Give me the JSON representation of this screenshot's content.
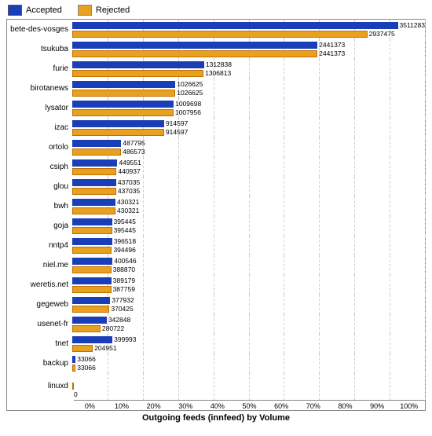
{
  "legend": {
    "accepted": {
      "label": "Accepted",
      "color": "#1a3eb8"
    },
    "rejected": {
      "label": "Rejected",
      "color": "#e8a020"
    }
  },
  "xTitle": "Outgoing feeds (innfeed) by Volume",
  "xTicks": [
    "0%",
    "10%",
    "20%",
    "30%",
    "40%",
    "50%",
    "60%",
    "70%",
    "80%",
    "90%",
    "100%"
  ],
  "maxValue": 3511283,
  "rows": [
    {
      "label": "bete-des-vosges",
      "accepted": 3511283,
      "rejected": 2937475
    },
    {
      "label": "tsukuba",
      "accepted": 2441373,
      "rejected": 2441373
    },
    {
      "label": "furie",
      "accepted": 1312838,
      "rejected": 1306813
    },
    {
      "label": "birotanews",
      "accepted": 1026625,
      "rejected": 1026625
    },
    {
      "label": "lysator",
      "accepted": 1009698,
      "rejected": 1007956
    },
    {
      "label": "izac",
      "accepted": 914597,
      "rejected": 914597
    },
    {
      "label": "ortolo",
      "accepted": 487795,
      "rejected": 486573
    },
    {
      "label": "csiph",
      "accepted": 449551,
      "rejected": 440937
    },
    {
      "label": "glou",
      "accepted": 437035,
      "rejected": 437035
    },
    {
      "label": "bwh",
      "accepted": 430321,
      "rejected": 430321
    },
    {
      "label": "goja",
      "accepted": 395445,
      "rejected": 395445
    },
    {
      "label": "nntp4",
      "accepted": 396518,
      "rejected": 394496
    },
    {
      "label": "niel.me",
      "accepted": 400546,
      "rejected": 388870
    },
    {
      "label": "weretis.net",
      "accepted": 389179,
      "rejected": 387759
    },
    {
      "label": "gegeweb",
      "accepted": 377932,
      "rejected": 370425
    },
    {
      "label": "usenet-fr",
      "accepted": 342848,
      "rejected": 280722
    },
    {
      "label": "tnet",
      "accepted": 399993,
      "rejected": 204951
    },
    {
      "label": "backup",
      "accepted": 33066,
      "rejected": 33066
    },
    {
      "label": "linuxd",
      "accepted": 0,
      "rejected": 0
    }
  ]
}
